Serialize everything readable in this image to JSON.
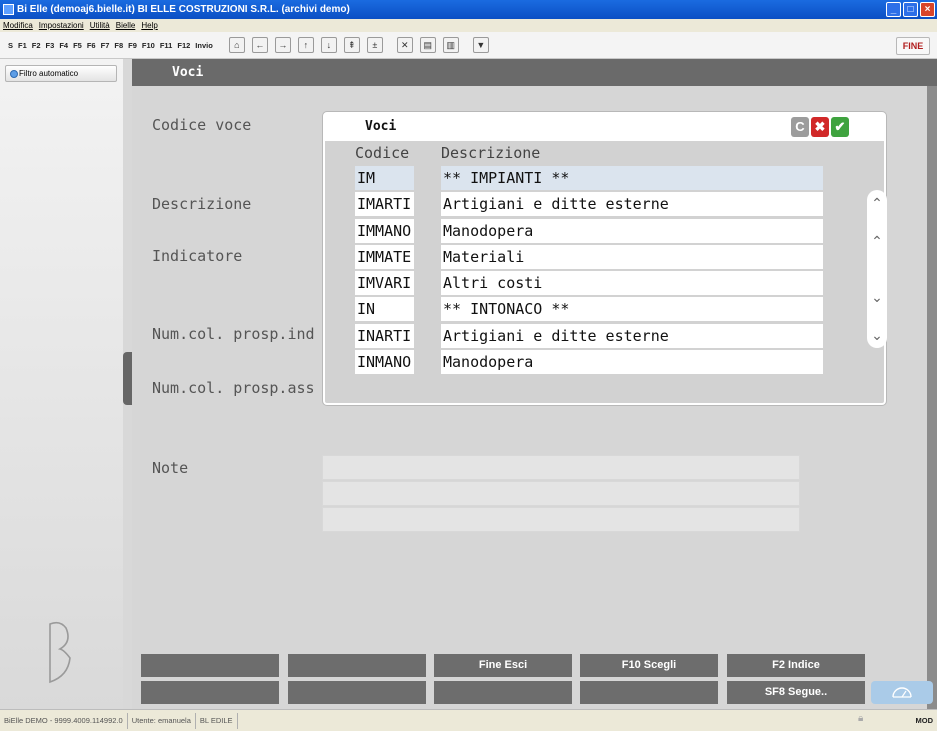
{
  "window": {
    "title": "Bi Elle (demoaj6.bielle.it)   BI ELLE COSTRUZIONI S.R.L. (archivi demo)"
  },
  "menu": [
    "Modifica",
    "Impostazioni",
    "Utilità",
    "Bielle",
    "Help"
  ],
  "toolbar": {
    "keys": [
      "S",
      "F1",
      "F2",
      "F3",
      "F4",
      "F5",
      "F6",
      "F7",
      "F8",
      "F9",
      "F10",
      "F11",
      "F12",
      "Invio"
    ],
    "icons": [
      "home-icon",
      "arrow-left-icon",
      "arrow-right-icon",
      "arrow-up-icon",
      "arrow-down-icon",
      "first-record-icon",
      "last-record-icon",
      "delete-icon",
      "copy-icon",
      "paste-icon",
      "print-icon"
    ],
    "fine_label": "FINE"
  },
  "sidebar": {
    "filter_label": "Filtro automatico"
  },
  "form": {
    "title": "Voci",
    "labels": {
      "codice": "Codice voce",
      "descrizione": "Descrizione",
      "indicatore": "Indicatore",
      "numcol_ind": "Num.col. prosp.ind",
      "numcol_ass": "Num.col. prosp.ass",
      "note": "Note"
    }
  },
  "function_buttons": {
    "row1": [
      "",
      "",
      "Fine  Esci",
      "F10  Scegli",
      "F2  Indice"
    ],
    "row2": [
      "",
      "",
      "",
      "",
      "SF8  Segue.."
    ]
  },
  "modal": {
    "title": "Voci",
    "columns": [
      "Codice",
      "Descrizione"
    ],
    "rows": [
      {
        "code": "IM",
        "desc": "** IMPIANTI **"
      },
      {
        "code": "IMARTI",
        "desc": "Artigiani e ditte esterne"
      },
      {
        "code": "IMMANO",
        "desc": "Manodopera"
      },
      {
        "code": "IMMATE",
        "desc": "Materiali"
      },
      {
        "code": "IMVARI",
        "desc": "Altri costi"
      },
      {
        "code": "IN",
        "desc": "** INTONACO **"
      },
      {
        "code": "INARTI",
        "desc": "Artigiani e ditte esterne"
      },
      {
        "code": "INMANO",
        "desc": "Manodopera"
      }
    ],
    "buttons": {
      "refresh": "C",
      "cancel": "✖",
      "confirm": "✔"
    }
  },
  "statusbar": {
    "version": "BiElle DEMO - 9999.4009.114992.0",
    "user": "Utente: emanuela",
    "company": "BL EDILE",
    "mode": "MOD"
  },
  "colors": {
    "accent": "#0b4fc4",
    "header_gray": "#6a6a6a",
    "fine_red": "#b11d1d",
    "modal_confirm": "#3fa33f",
    "modal_cancel": "#d12828"
  }
}
